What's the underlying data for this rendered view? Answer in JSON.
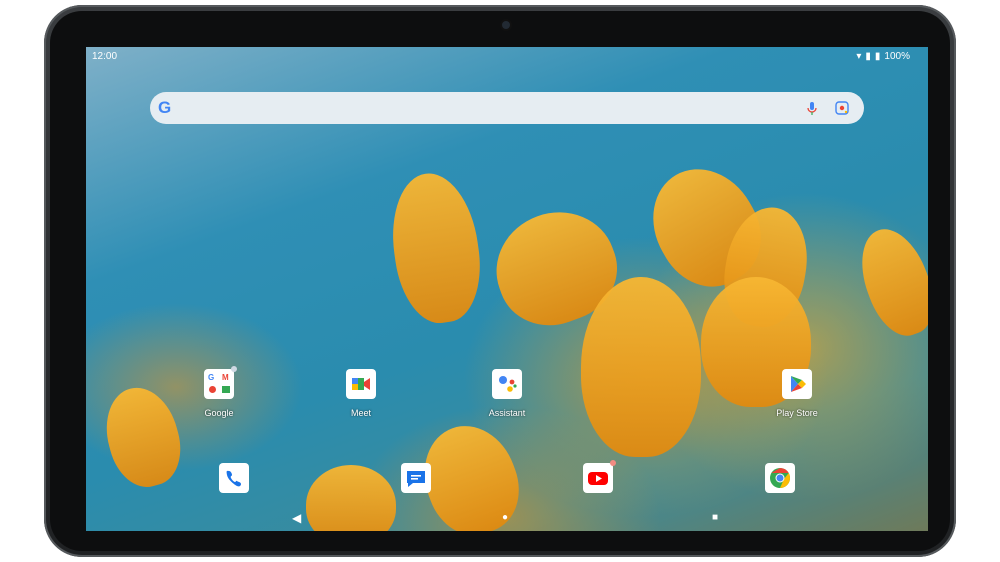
{
  "status_bar": {
    "time": "12:00",
    "battery": "100%"
  },
  "search": {
    "logo": "G",
    "mic_icon": "mic-icon",
    "lens_icon": "lens-icon"
  },
  "apps": [
    {
      "label": "Google",
      "icon": "google-folder-icon"
    },
    {
      "label": "Meet",
      "icon": "meet-icon"
    },
    {
      "label": "Assistant",
      "icon": "assistant-icon"
    },
    {
      "label": "Play Store",
      "icon": "play-store-icon"
    }
  ],
  "dock": [
    {
      "icon": "phone-icon"
    },
    {
      "icon": "messages-icon"
    },
    {
      "icon": "youtube-icon"
    },
    {
      "icon": "chrome-icon"
    }
  ],
  "nav": {
    "back": "◀",
    "home": "●",
    "recents": "■"
  },
  "colors": {
    "google_blue": "#4285F4",
    "google_red": "#EA4335",
    "google_yellow": "#FBBC05",
    "google_green": "#34A853"
  }
}
